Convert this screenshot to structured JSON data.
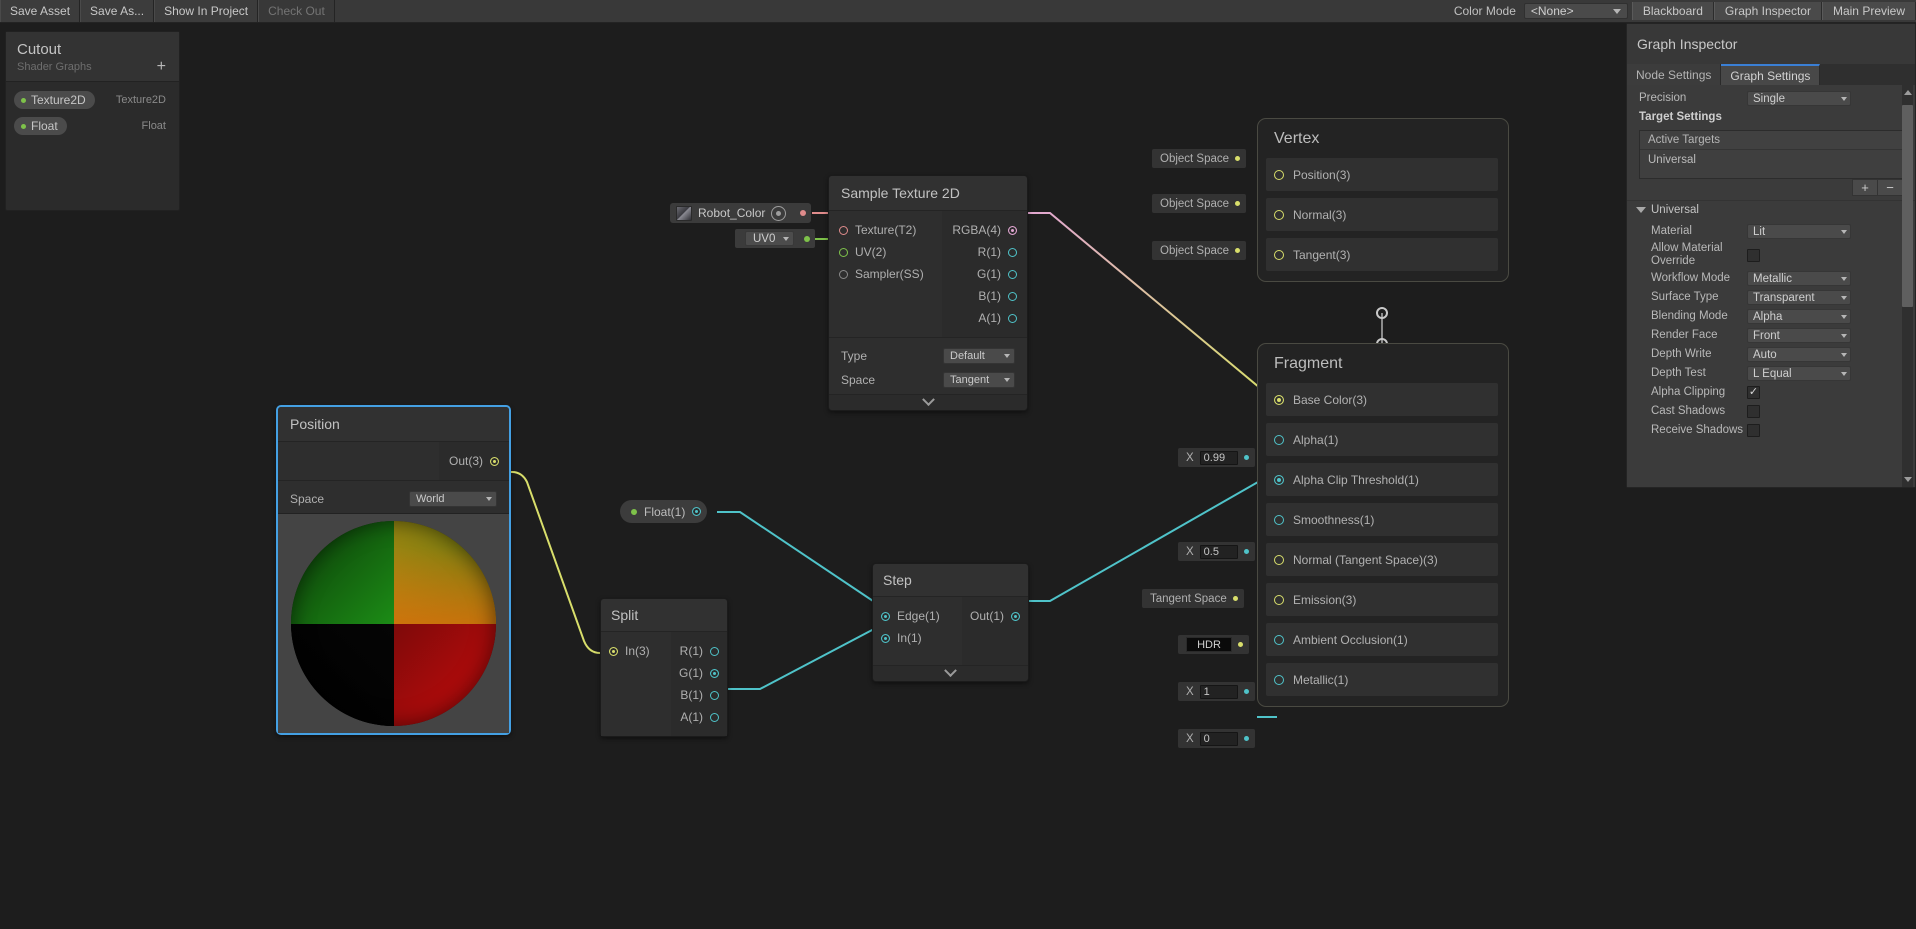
{
  "toolbar": {
    "buttons": [
      {
        "label": "Save Asset",
        "disabled": false
      },
      {
        "label": "Save As...",
        "disabled": false
      },
      {
        "label": "Show In Project",
        "disabled": false
      },
      {
        "label": "Check Out",
        "disabled": true
      }
    ],
    "color_mode_label": "Color Mode",
    "color_mode_value": "<None>",
    "toggles": [
      "Blackboard",
      "Graph Inspector",
      "Main Preview"
    ]
  },
  "blackboard": {
    "title": "Cutout",
    "subtitle": "Shader Graphs",
    "add_label": "+",
    "properties": [
      {
        "name": "Texture2D",
        "type": "Texture2D"
      },
      {
        "name": "Float",
        "type": "Float"
      }
    ]
  },
  "nodes": {
    "position": {
      "title": "Position",
      "out_label": "Out(3)",
      "space_label": "Space",
      "space_value": "World"
    },
    "sample_texture": {
      "title": "Sample Texture 2D",
      "inputs": [
        "Texture(T2)",
        "UV(2)",
        "Sampler(SS)"
      ],
      "outputs": [
        "RGBA(4)",
        "R(1)",
        "G(1)",
        "B(1)",
        "A(1)"
      ],
      "type_label": "Type",
      "type_value": "Default",
      "space_label": "Space",
      "space_value": "Tangent"
    },
    "split": {
      "title": "Split",
      "input": "In(3)",
      "outputs": [
        "R(1)",
        "G(1)",
        "B(1)",
        "A(1)"
      ]
    },
    "step": {
      "title": "Step",
      "inputs": [
        "Edge(1)",
        "In(1)"
      ],
      "output": "Out(1)"
    },
    "robot_color_property": "Robot_Color",
    "uv_property": "UV0",
    "float_property": "Float(1)"
  },
  "vertex_stack": {
    "title": "Vertex",
    "blocks": [
      {
        "label": "Position(3)",
        "default": "Object Space"
      },
      {
        "label": "Normal(3)",
        "default": "Object Space"
      },
      {
        "label": "Tangent(3)",
        "default": "Object Space"
      }
    ]
  },
  "fragment_stack": {
    "title": "Fragment",
    "blocks": [
      {
        "label": "Base Color(3)",
        "default": null,
        "connected": true
      },
      {
        "label": "Alpha(1)",
        "default": "0.99",
        "prefix": "X"
      },
      {
        "label": "Alpha Clip Threshold(1)",
        "default": null,
        "connected": true
      },
      {
        "label": "Smoothness(1)",
        "default": "0.5",
        "prefix": "X"
      },
      {
        "label": "Normal (Tangent Space)(3)",
        "default": "Tangent Space"
      },
      {
        "label": "Emission(3)",
        "default": "HDR"
      },
      {
        "label": "Ambient Occlusion(1)",
        "default": "1",
        "prefix": "X"
      },
      {
        "label": "Metallic(1)",
        "default": "0",
        "prefix": "X"
      }
    ]
  },
  "inspector": {
    "title": "Graph Inspector",
    "tabs": [
      {
        "label": "Node Settings",
        "active": false
      },
      {
        "label": "Graph Settings",
        "active": true
      }
    ],
    "precision_label": "Precision",
    "precision_value": "Single",
    "target_settings_label": "Target Settings",
    "active_targets_label": "Active Targets",
    "active_target": "Universal",
    "add_target": "+",
    "remove_target": "−",
    "universal_foldout": "Universal",
    "settings": [
      {
        "label": "Material",
        "type": "combo",
        "value": "Lit"
      },
      {
        "label": "Allow Material Override",
        "type": "check",
        "value": false
      },
      {
        "label": "Workflow Mode",
        "type": "combo",
        "value": "Metallic"
      },
      {
        "label": "Surface Type",
        "type": "combo",
        "value": "Transparent"
      },
      {
        "label": "Blending Mode",
        "type": "combo",
        "value": "Alpha"
      },
      {
        "label": "Render Face",
        "type": "combo",
        "value": "Front"
      },
      {
        "label": "Depth Write",
        "type": "combo",
        "value": "Auto"
      },
      {
        "label": "Depth Test",
        "type": "combo",
        "value": "L Equal"
      },
      {
        "label": "Alpha Clipping",
        "type": "check",
        "value": true
      },
      {
        "label": "Cast Shadows",
        "type": "check",
        "value": false
      },
      {
        "label": "Receive Shadows",
        "type": "check",
        "value": false
      }
    ]
  },
  "colors": {
    "accent_blue": "#44a0e3",
    "wire_yellow": "#d8de6b",
    "wire_cyan": "#4fc3c9",
    "wire_pink": "#e2a6d2",
    "property_green": "#7ec24a",
    "canvas_bg": "#1d1d1d"
  }
}
